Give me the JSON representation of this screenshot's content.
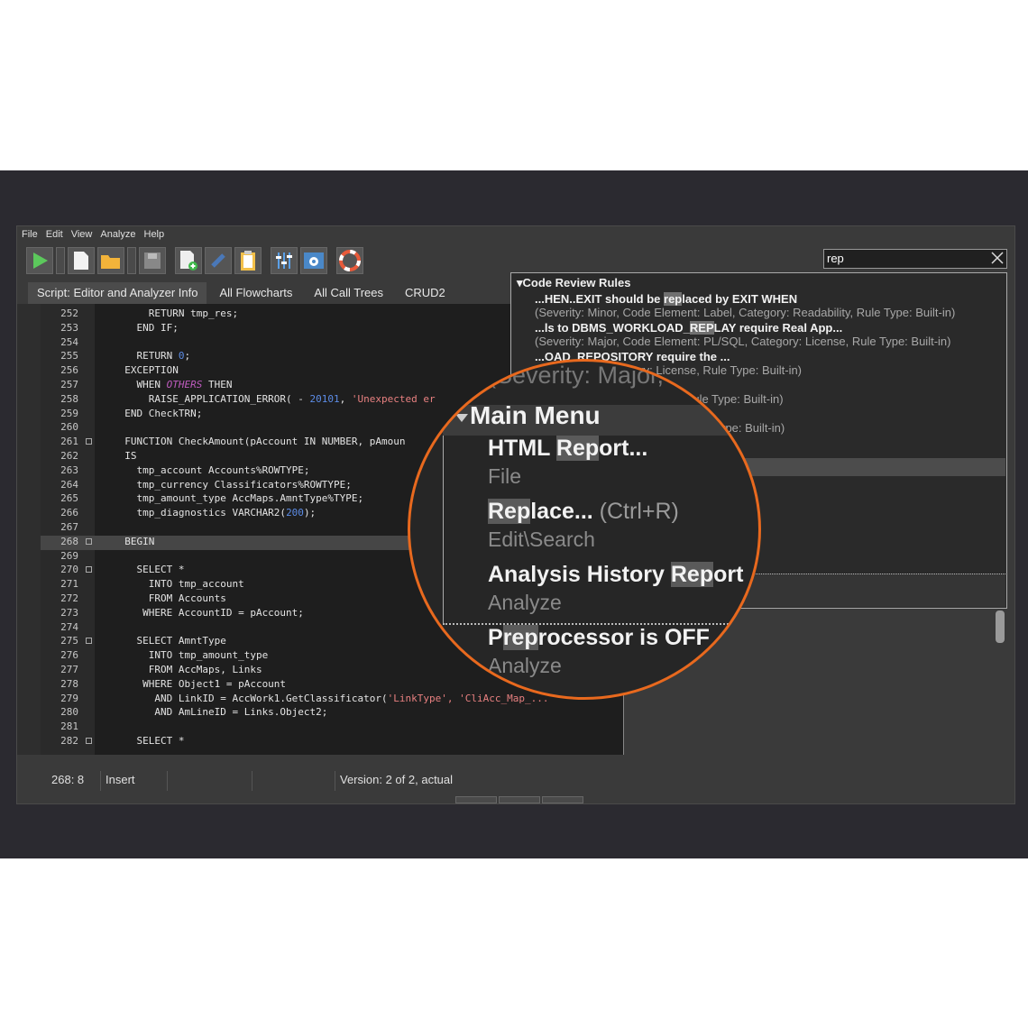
{
  "menu": [
    "File",
    "Edit",
    "View",
    "Analyze",
    "Help"
  ],
  "search": {
    "value": "rep"
  },
  "tabs": [
    {
      "label": "Script: Editor and Analyzer Info"
    },
    {
      "label": "All Flowcharts"
    },
    {
      "label": "All Call Trees"
    },
    {
      "label": "CRUD2"
    }
  ],
  "editor": {
    "lines": [
      {
        "n": "252",
        "code": "      RETURN tmp_res;"
      },
      {
        "n": "253",
        "code": "    END IF;"
      },
      {
        "n": "254",
        "code": ""
      },
      {
        "n": "255",
        "code": "    RETURN ",
        "num": "0",
        "rest": ";"
      },
      {
        "n": "256",
        "code": "  EXCEPTION"
      },
      {
        "n": "257",
        "code": "    WHEN ",
        "oth": "OTHERS",
        "rest": " THEN"
      },
      {
        "n": "258",
        "code": "      RAISE_APPLICATION_ERROR( - ",
        "num": "20101",
        "rest": ", ",
        "str": "'Unexpected er"
      },
      {
        "n": "259",
        "code": "  END CheckTRN;"
      },
      {
        "n": "260",
        "code": ""
      },
      {
        "n": "261",
        "code": "  FUNCTION CheckAmount(pAccount IN NUMBER, pAmoun"
      },
      {
        "n": "262",
        "code": "  IS"
      },
      {
        "n": "263",
        "code": "    tmp_account Accounts%ROWTYPE;"
      },
      {
        "n": "264",
        "code": "    tmp_currency Classificators%ROWTYPE;"
      },
      {
        "n": "265",
        "code": "    tmp_amount_type AccMaps.AmntType%TYPE;"
      },
      {
        "n": "266",
        "code": "    tmp_diagnostics VARCHAR2(",
        "num": "200",
        "rest": ");"
      },
      {
        "n": "267",
        "code": ""
      },
      {
        "n": "268",
        "code": "  BEGIN"
      },
      {
        "n": "269",
        "code": ""
      },
      {
        "n": "270",
        "code": "    SELECT *"
      },
      {
        "n": "271",
        "code": "      INTO tmp_account"
      },
      {
        "n": "272",
        "code": "      FROM Accounts"
      },
      {
        "n": "273",
        "code": "     WHERE AccountID = pAccount;"
      },
      {
        "n": "274",
        "code": ""
      },
      {
        "n": "275",
        "code": "    SELECT AmntType"
      },
      {
        "n": "276",
        "code": "      INTO tmp_amount_type"
      },
      {
        "n": "277",
        "code": "      FROM AccMaps, Links"
      },
      {
        "n": "278",
        "code": "     WHERE Object1 = pAccount"
      },
      {
        "n": "279",
        "code": "       AND LinkID = AccWork1.GetClassificator(",
        "str": "'LinkType', 'CliAcc_Map_..."
      },
      {
        "n": "280",
        "code": "       AND AmLineID = Links.Object2;"
      },
      {
        "n": "281",
        "code": ""
      },
      {
        "n": "282",
        "code": "    SELECT *"
      }
    ]
  },
  "dropdown": {
    "header": "Code Review Rules",
    "rules": [
      {
        "title_pre": "...HEN..EXIT should be ",
        "title_hl": "rep",
        "title_post": "laced by EXIT WHEN",
        "meta": "(Severity: Minor, Code Element: Label, Category: Readability, Rule Type: Built-in)"
      },
      {
        "title_pre": "...ls to DBMS_WORKLOAD_",
        "title_hl": "REP",
        "title_post": "LAY require Real App...",
        "meta": "(Severity: Major, Code Element: PL/SQL, Category: License, Rule Type: Built-in)"
      },
      {
        "title_pre": "",
        "title_hl": "",
        "title_post": "...OAD_REPOSITORY require the ...",
        "meta": "...t: PL/SQL, Category: License, Rule Type: Built-in)"
      },
      {
        "title_pre": "",
        "title_hl": "",
        "title_post": "",
        "meta": "...sor, Category: Readability, Rule Type: Built-in)"
      },
      {
        "title_pre": "",
        "title_hl": "",
        "title_post": "",
        "meta": "...tegory: Program Structure, Rule Type: Built-in)"
      }
    ]
  },
  "magnifier": {
    "ghost": "(Severity: Major, Co",
    "header": "Main Menu",
    "items": [
      {
        "pre": "HTML ",
        "hl": "Rep",
        "post": "ort...",
        "hotkey": "",
        "sub": "File"
      },
      {
        "pre": "",
        "hl": "Rep",
        "post": "lace...",
        "hotkey": "(Ctrl+R)",
        "sub": "Edit\\Search"
      },
      {
        "pre": "Analysis History ",
        "hl": "Rep",
        "post": "ort",
        "hotkey": "",
        "sub": "Analyze"
      },
      {
        "pre": "P",
        "hl": "rep",
        "post": "rocessor is OFF",
        "hotkey": "",
        "sub": "Analyze"
      }
    ]
  },
  "status": {
    "pos": "268:  8",
    "mode": "Insert",
    "version": "Version: 2 of 2, actual"
  },
  "colors": {
    "accent": "#e8691e",
    "background": "#2b2a30"
  }
}
